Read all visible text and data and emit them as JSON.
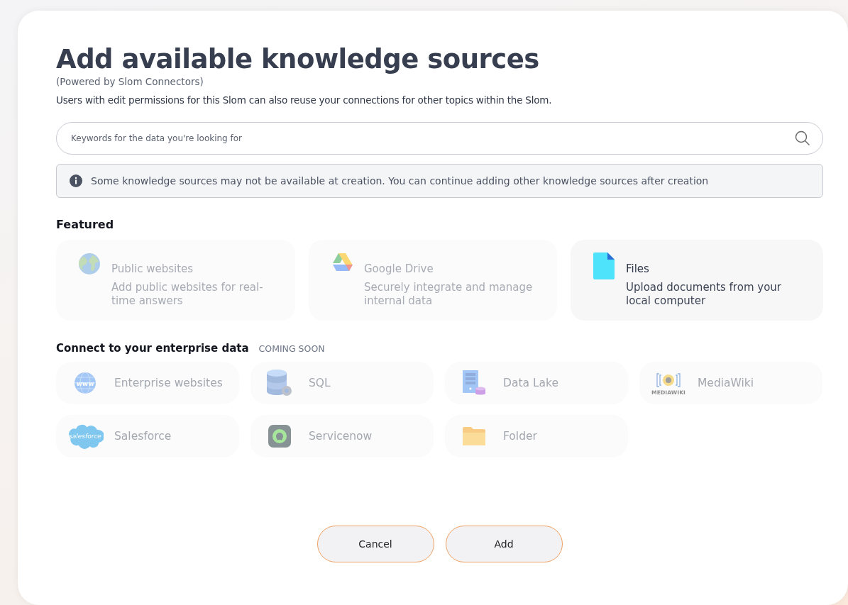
{
  "dialog": {
    "title": "Add available knowledge sources",
    "subtitle": "(Powered by Slom Connectors)",
    "description": "Users with edit permissions for this Slom can also reuse your connections for other topics within the Slom."
  },
  "search": {
    "placeholder": "Keywords for the data you're looking for"
  },
  "notice": {
    "text": "Some knowledge sources may not be available at creation. You can continue adding other knowledge sources after creation"
  },
  "featured": {
    "heading": "Featured",
    "items": [
      {
        "kind": "globe",
        "title": "Public websites",
        "description": "Add public websites for real-time answers",
        "disabled": true
      },
      {
        "kind": "drive",
        "title": "Google Drive",
        "description": "Securely integrate and manage internal data",
        "disabled": true
      },
      {
        "kind": "file",
        "title": "Files",
        "description": "Upload documents from your local computer",
        "disabled": false
      }
    ]
  },
  "enterprise": {
    "heading": "Connect to your enterprise data",
    "badge": "COMING SOON",
    "items": [
      {
        "kind": "www",
        "label": "Enterprise websites",
        "disabled": true
      },
      {
        "kind": "database",
        "label": "SQL",
        "disabled": true
      },
      {
        "kind": "server",
        "label": "Data Lake",
        "disabled": true
      },
      {
        "kind": "wiki",
        "label": "MediaWiki",
        "logo_text": "MEDIAWIKI",
        "disabled": true
      },
      {
        "kind": "cloud",
        "label": "Salesforce",
        "logo_text": "salesforce",
        "disabled": true
      },
      {
        "kind": "ring",
        "label": "Servicenow",
        "disabled": true
      },
      {
        "kind": "folder",
        "label": "Folder",
        "disabled": true
      }
    ]
  },
  "buttons": [
    "Cancel",
    "Add"
  ]
}
